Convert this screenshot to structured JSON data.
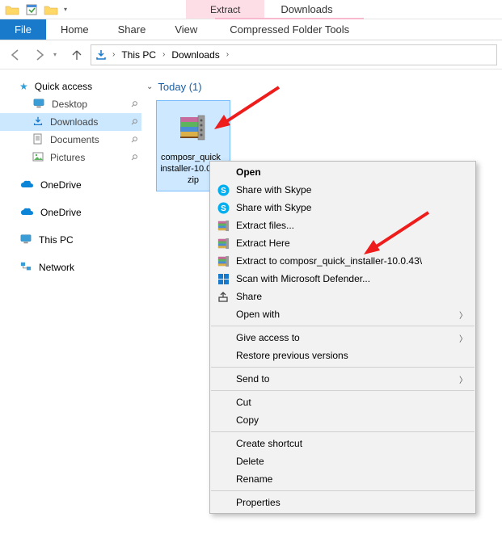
{
  "titlebar": {
    "contextual": "Extract",
    "title": "Downloads"
  },
  "tabs": {
    "file": "File",
    "home": "Home",
    "share": "Share",
    "view": "View",
    "contextual": "Compressed Folder Tools"
  },
  "breadcrumb": {
    "root": "This PC",
    "folder": "Downloads"
  },
  "sidebar": {
    "quick_access": "Quick access",
    "desktop": "Desktop",
    "downloads": "Downloads",
    "documents": "Documents",
    "pictures": "Pictures",
    "onedrive1": "OneDrive",
    "onedrive2": "OneDrive",
    "this_pc": "This PC",
    "network": "Network"
  },
  "content": {
    "group_header": "Today (1)",
    "file_label": "composr_quick_installer-10.0.43.zip"
  },
  "context_menu": {
    "open": "Open",
    "skype1": "Share with Skype",
    "skype2": "Share with Skype",
    "extract_files": "Extract files...",
    "extract_here": "Extract Here",
    "extract_to": "Extract to composr_quick_installer-10.0.43\\",
    "defender": "Scan with Microsoft Defender...",
    "share": "Share",
    "open_with": "Open with",
    "give_access": "Give access to",
    "restore": "Restore previous versions",
    "send_to": "Send to",
    "cut": "Cut",
    "copy": "Copy",
    "create_shortcut": "Create shortcut",
    "delete": "Delete",
    "rename": "Rename",
    "properties": "Properties"
  }
}
